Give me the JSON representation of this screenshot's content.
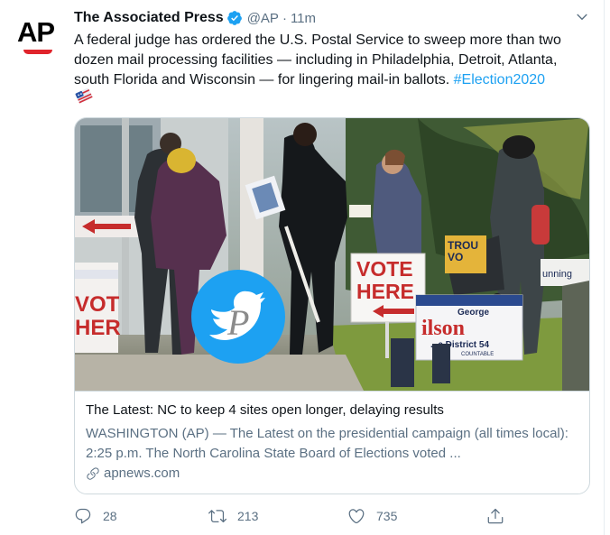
{
  "tweet": {
    "author_name": "The Associated Press",
    "handle": "@AP",
    "separator": "·",
    "time": "11m",
    "avatar_text": "AP",
    "text_line_1": "A federal judge has ordered the U.S. Postal Service to sweep more than two",
    "text_line_2": "dozen mail processing facilities — including in Philadelphia, Detroit, Atlanta,",
    "text_line_3": "south Florida and Wisconsin — for lingering mail-in ballots.",
    "hashtag": "#Election2020"
  },
  "card": {
    "title": "The Latest: NC to keep 4 sites open longer, delaying results",
    "description": "WASHINGTON (AP) — The Latest on the presidential campaign (all times local): 2:25 p.m. The North Carolina State Board of Elections voted ...",
    "domain": "apnews.com",
    "image_signs": {
      "vote_here_1": "VOTE",
      "vote_here_2": "HERE",
      "left_sign_1": "VOT",
      "left_sign_2": "HER",
      "candidate_first": "George",
      "candidate_last": "ilson",
      "district": "...e District 54",
      "countable": "COUNTABLE",
      "trou_1": "TROU",
      "trou_2": "VO",
      "running": "unning"
    }
  },
  "actions": {
    "replies": "28",
    "retweets": "213",
    "likes": "735"
  },
  "colors": {
    "accent": "#1da1f2",
    "secondary_text": "#5b7083",
    "border": "#cfd9de",
    "ap_red": "#e0242c"
  },
  "icons": {
    "verified": "verified-badge-icon",
    "caret": "chevron-down-icon",
    "reply": "reply-icon",
    "retweet": "retweet-icon",
    "like": "heart-icon",
    "share": "share-icon",
    "link": "link-icon",
    "flag_emoji": "ballot-flag-emoji-icon",
    "watermark": "twitter-bird-watermark-icon"
  }
}
